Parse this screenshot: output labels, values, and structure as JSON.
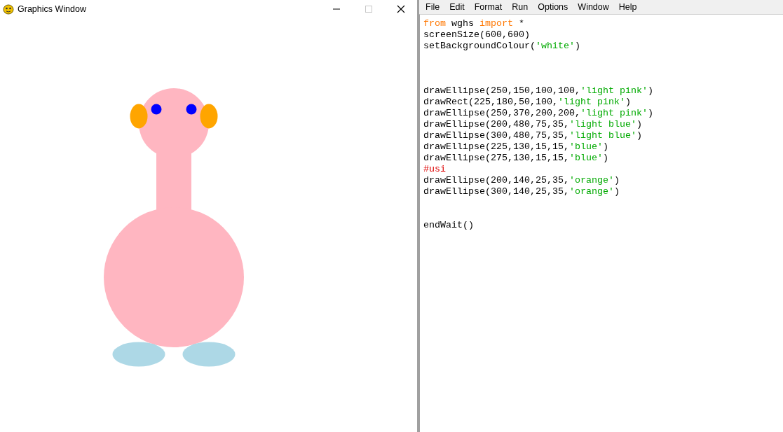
{
  "graphics_window": {
    "title": "Graphics Window",
    "maximize_disabled": true
  },
  "editor": {
    "menu": [
      "File",
      "Edit",
      "Format",
      "Run",
      "Options",
      "Window",
      "Help"
    ],
    "lines": [
      {
        "kind": "code",
        "tokens": [
          {
            "text": "from",
            "kind": "keyword"
          },
          {
            "text": " wghs ",
            "kind": "plain"
          },
          {
            "text": "import",
            "kind": "keyword"
          },
          {
            "text": " *",
            "kind": "plain"
          }
        ]
      },
      {
        "kind": "code",
        "tokens": [
          {
            "text": "screenSize(600,600)",
            "kind": "plain"
          }
        ]
      },
      {
        "kind": "code",
        "tokens": [
          {
            "text": "setBackgroundColour(",
            "kind": "plain"
          },
          {
            "text": "'white'",
            "kind": "string"
          },
          {
            "text": ")",
            "kind": "plain"
          }
        ]
      },
      {
        "kind": "blank"
      },
      {
        "kind": "blank"
      },
      {
        "kind": "blank"
      },
      {
        "kind": "code",
        "tokens": [
          {
            "text": "drawEllipse(250,150,100,100,",
            "kind": "plain"
          },
          {
            "text": "'light pink'",
            "kind": "string"
          },
          {
            "text": ")",
            "kind": "plain"
          }
        ]
      },
      {
        "kind": "code",
        "tokens": [
          {
            "text": "drawRect(225,180,50,100,",
            "kind": "plain"
          },
          {
            "text": "'light pink'",
            "kind": "string"
          },
          {
            "text": ")",
            "kind": "plain"
          }
        ]
      },
      {
        "kind": "code",
        "tokens": [
          {
            "text": "drawEllipse(250,370,200,200,",
            "kind": "plain"
          },
          {
            "text": "'light pink'",
            "kind": "string"
          },
          {
            "text": ")",
            "kind": "plain"
          }
        ]
      },
      {
        "kind": "code",
        "tokens": [
          {
            "text": "drawEllipse(200,480,75,35,",
            "kind": "plain"
          },
          {
            "text": "'light blue'",
            "kind": "string"
          },
          {
            "text": ")",
            "kind": "plain"
          }
        ]
      },
      {
        "kind": "code",
        "tokens": [
          {
            "text": "drawEllipse(300,480,75,35,",
            "kind": "plain"
          },
          {
            "text": "'light blue'",
            "kind": "string"
          },
          {
            "text": ")",
            "kind": "plain"
          }
        ]
      },
      {
        "kind": "code",
        "tokens": [
          {
            "text": "drawEllipse(225,130,15,15,",
            "kind": "plain"
          },
          {
            "text": "'blue'",
            "kind": "string"
          },
          {
            "text": ")",
            "kind": "plain"
          }
        ]
      },
      {
        "kind": "code",
        "tokens": [
          {
            "text": "drawEllipse(275,130,15,15,",
            "kind": "plain"
          },
          {
            "text": "'blue'",
            "kind": "string"
          },
          {
            "text": ")",
            "kind": "plain"
          }
        ]
      },
      {
        "kind": "code",
        "tokens": [
          {
            "text": "#usi",
            "kind": "comment"
          }
        ]
      },
      {
        "kind": "code",
        "tokens": [
          {
            "text": "drawEllipse(200,140,25,35,",
            "kind": "plain"
          },
          {
            "text": "'orange'",
            "kind": "string"
          },
          {
            "text": ")",
            "kind": "plain"
          }
        ]
      },
      {
        "kind": "code",
        "tokens": [
          {
            "text": "drawEllipse(300,140,25,35,",
            "kind": "plain"
          },
          {
            "text": "'orange'",
            "kind": "string"
          },
          {
            "text": ")",
            "kind": "plain"
          }
        ]
      },
      {
        "kind": "blank"
      },
      {
        "kind": "blank"
      },
      {
        "kind": "code",
        "tokens": [
          {
            "text": "endWait()",
            "kind": "plain"
          }
        ]
      }
    ]
  }
}
